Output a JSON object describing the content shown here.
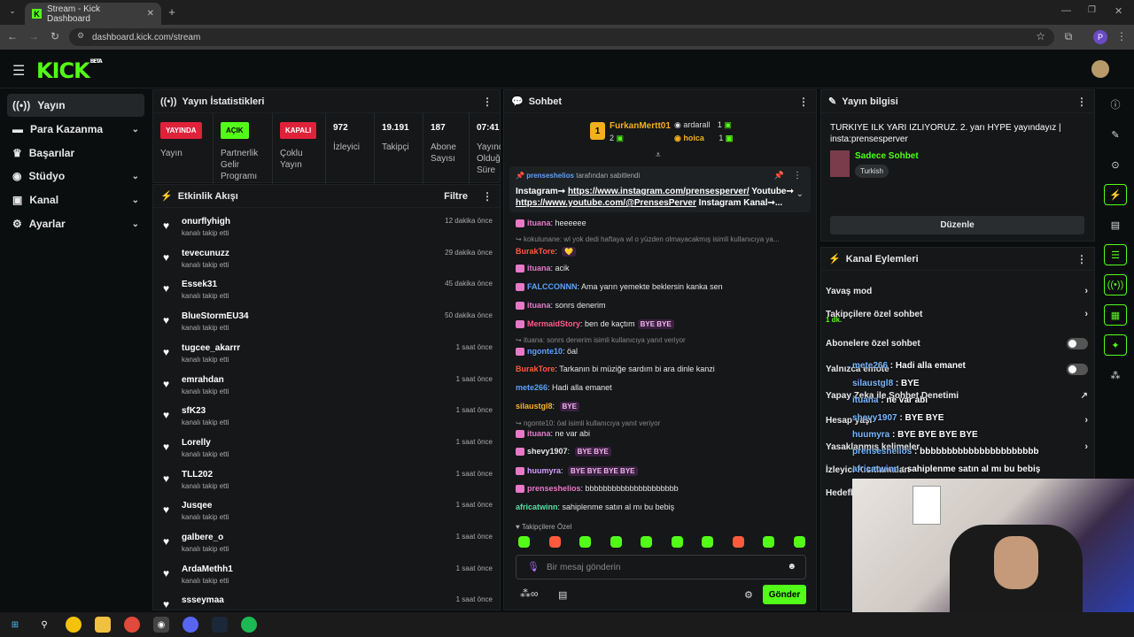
{
  "browser": {
    "tab_title": "Stream - Kick Dashboard",
    "url": "dashboard.kick.com/stream",
    "profile": "P"
  },
  "app": {
    "logo": "KICK",
    "beta": "BETA"
  },
  "sidebar": {
    "items": [
      {
        "label": "Yayın",
        "icon": "broadcast-icon",
        "selected": true,
        "chevron": false
      },
      {
        "label": "Para Kazanma",
        "icon": "money-icon",
        "chevron": true
      },
      {
        "label": "Başarılar",
        "icon": "trophy-icon",
        "chevron": false
      },
      {
        "label": "Stüdyo",
        "icon": "studio-icon",
        "chevron": true
      },
      {
        "label": "Kanal",
        "icon": "channel-icon",
        "chevron": true
      },
      {
        "label": "Ayarlar",
        "icon": "gear-icon",
        "chevron": true
      }
    ]
  },
  "stats": {
    "title": "Yayın İstatistikleri",
    "items": [
      {
        "value": "YAYINDA",
        "label": "Yayın",
        "badge": "red"
      },
      {
        "value": "AÇIK",
        "label": "Partnerlik Gelir Programı",
        "badge": "green"
      },
      {
        "value": "KAPALI",
        "label": "Çoklu Yayın",
        "badge": "red"
      },
      {
        "value": "972",
        "label": "İzleyici"
      },
      {
        "value": "19.191",
        "label": "Takipçi"
      },
      {
        "value": "187",
        "label": "Abone Sayısı"
      },
      {
        "value": "07:41",
        "label": "Yayında Olduğu Süre"
      }
    ]
  },
  "activity": {
    "title": "Etkinlik Akışı",
    "filter": "Filtre",
    "items": [
      {
        "name": "onurflyhigh",
        "sub": "kanalı takip etti",
        "time": "12 dakika önce"
      },
      {
        "name": "tevecunuzz",
        "sub": "kanalı takip etti",
        "time": "29 dakika önce"
      },
      {
        "name": "Essek31",
        "sub": "kanalı takip etti",
        "time": "45 dakika önce"
      },
      {
        "name": "BlueStormEU34",
        "sub": "kanalı takip etti",
        "time": "50 dakika önce"
      },
      {
        "name": "tugcee_akarrr",
        "sub": "kanalı takip etti",
        "time": "1 saat önce"
      },
      {
        "name": "emrahdan",
        "sub": "kanalı takip etti",
        "time": "1 saat önce"
      },
      {
        "name": "sfK23",
        "sub": "kanalı takip etti",
        "time": "1 saat önce"
      },
      {
        "name": "Lorelly",
        "sub": "kanalı takip etti",
        "time": "1 saat önce"
      },
      {
        "name": "TLL202",
        "sub": "kanalı takip etti",
        "time": "1 saat önce"
      },
      {
        "name": "Jusqee",
        "sub": "kanalı takip etti",
        "time": "1 saat önce"
      },
      {
        "name": "galbere_o",
        "sub": "kanalı takip etti",
        "time": "1 saat önce"
      },
      {
        "name": "ArdaMethh1",
        "sub": "kanalı takip etti",
        "time": "1 saat önce"
      },
      {
        "name": "ssseymaa",
        "sub": "",
        "time": "1 saat önce"
      }
    ]
  },
  "chat": {
    "title": "Sohbet",
    "leaders": {
      "first_name": "FurkanMertt01",
      "first_count": "2",
      "rank": "1",
      "second_name": "ardarall",
      "second_count": "1",
      "third_name": "hoica",
      "third_count": "1"
    },
    "pinned": {
      "by": "prenseshelios",
      "by_suffix": "tarafından sabitlendi",
      "line1a": "Instagram➞ ",
      "link1": "https://www.instagram.com/prensesperver/",
      "line1b": " Youtube➞",
      "link2": "https://www.youtube.com/@PrensesPerver",
      "line2b": " Instagram Kanal➞..."
    },
    "messages": [
      {
        "user": "ituana",
        "color": "#e879c9",
        "text": "heeeeee",
        "emote": ""
      },
      {
        "reply": "kokulunane: wl yok dedi haftaya wl o yüzden olmayacakmış isimli kullanıcıya ya..."
      },
      {
        "user": "BurakTore",
        "color": "#ff5a3c",
        "text": "",
        "emote": "💛"
      },
      {
        "user": "ituana",
        "color": "#e879c9",
        "text": "acik",
        "emote": ""
      },
      {
        "user": "FALCCONNN",
        "color": "#5aa2ff",
        "text": "Ama yarın yemekte beklersin kanka sen",
        "emote": ""
      },
      {
        "user": "ituana",
        "color": "#e879c9",
        "text": "sonrs denerim",
        "emote": ""
      },
      {
        "user": "MermaidStory",
        "color": "#ff5a8c",
        "text": "ben de kaçtım",
        "emote": "BYE BYE"
      },
      {
        "reply": "ituana: sonrs denerim isimli kullanıcıya yanıt veriyor"
      },
      {
        "user": "ngonte10",
        "color": "#5aa2ff",
        "text": "öal",
        "emote": ""
      },
      {
        "user": "BurakTore",
        "color": "#ff5a3c",
        "text": "Tarkanın bi müziğe sardım bi ara dinle kanzi",
        "emote": ""
      },
      {
        "user": "mete266",
        "color": "#5aa2ff",
        "text": "Hadi alla emanet",
        "emote": ""
      },
      {
        "user": "silaustgl8",
        "color": "#ffb020",
        "text": "",
        "emote": "BYE"
      },
      {
        "reply": "ngonte10: öal isimli kullanıcıya yanıt veriyor"
      },
      {
        "user": "ituana",
        "color": "#e879c9",
        "text": "ne var abi",
        "emote": ""
      },
      {
        "user": "shevy1907",
        "color": "#e6e6e6",
        "text": "",
        "emote": "BYE BYE"
      },
      {
        "user": "huumyra",
        "color": "#d69cff",
        "text": "",
        "emote": "BYE BYE BYE BYE"
      },
      {
        "user": "prenseshelios",
        "color": "#e879c9",
        "text": "bbbbbbbbbbbbbbbbbbbbb",
        "emote": ""
      },
      {
        "user": "africatwinn",
        "color": "#53e0a8",
        "text": "sahiplenme satın al mı bu bebiş",
        "emote": ""
      }
    ],
    "followers_only": "Takipçilere Özel",
    "placeholder": "Bir mesaj gönderin",
    "send": "Gönder",
    "infinity": "∞"
  },
  "stream_info": {
    "title_label": "Yayın bilgisi",
    "title": "TURKIYE ILK YARI IZLIYORUZ. 2. yarı HYPE yayındayız | insta:prensesperver",
    "category": "Sadece Sohbet",
    "tag": "Turkish",
    "edit": "Düzenle"
  },
  "channel_actions": {
    "title": "Kanal Eylemleri",
    "items": [
      {
        "label": "Yavaş mod",
        "type": "chevron"
      },
      {
        "label": "Takipçilere özel sohbet",
        "sub": "1 dk.",
        "type": "chevron"
      },
      {
        "label": "Abonelere özel sohbet",
        "type": "toggle"
      },
      {
        "label": "Yalnızca emote",
        "type": "toggle"
      },
      {
        "label": "Yapay Zeka ile Sohbet Denetimi",
        "type": "external"
      },
      {
        "label": "Hesap yaşı",
        "type": "chevron"
      },
      {
        "label": "Yasaklanmış kelimeler",
        "type": "chevron"
      },
      {
        "label": "İzleyici Kısıtlamaları",
        "type": "none"
      },
      {
        "label": "Hedefler",
        "type": "none"
      }
    ]
  },
  "overlay_chat": [
    {
      "user": "mete266",
      "text": "Hadi alla emanet"
    },
    {
      "user": "silaustgl8",
      "text": "BYE"
    },
    {
      "user": "ituana",
      "text": "ne var abi"
    },
    {
      "user": "shevy1907",
      "text": "BYE BYE"
    },
    {
      "user": "huumyra",
      "text": "BYE BYE BYE BYE"
    },
    {
      "user": "prenseshelios",
      "text": "bbbbbbbbbbbbbbbbbbbbbb"
    },
    {
      "user": "africatwinn",
      "text": "sahiplenme satın al mı bu bebiş"
    }
  ]
}
